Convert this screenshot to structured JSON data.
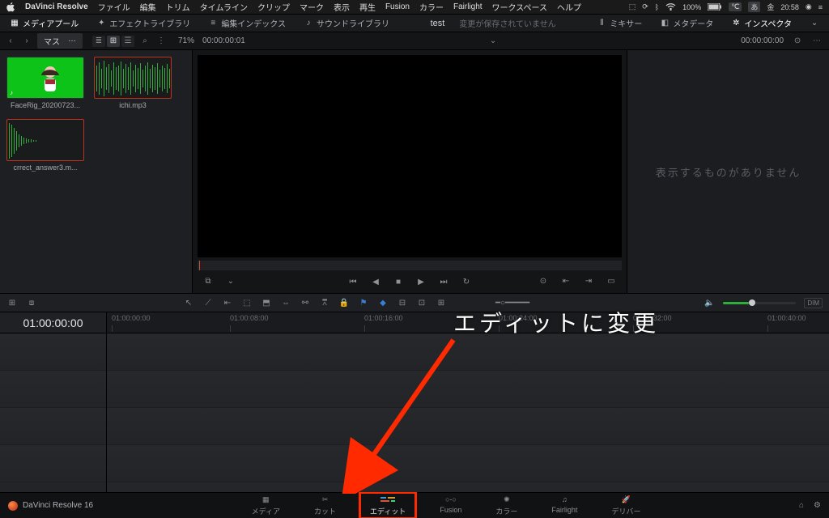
{
  "menubar": {
    "apple": "",
    "app": "DaVinci Resolve",
    "items": [
      "ファイル",
      "編集",
      "トリム",
      "タイムライン",
      "クリップ",
      "マーク",
      "表示",
      "再生",
      "Fusion",
      "カラー",
      "Fairlight",
      "ワークスペース",
      "ヘルプ"
    ],
    "status": {
      "battery": "100%",
      "ime1": "℃",
      "ime2": "あ",
      "day": "金",
      "time": "20:58"
    }
  },
  "toolbar": {
    "mediapool": "メディアプール",
    "effects": "エフェクトライブラリ",
    "editindex": "編集インデックス",
    "soundlib": "サウンドライブラリ",
    "title": "test",
    "unsaved": "変更が保存されていません",
    "mixer": "ミキサー",
    "metadata": "メタデータ",
    "inspector": "インスペクタ"
  },
  "subbar": {
    "crumb": "マス",
    "zoom": "71%",
    "tc_in": "00:00:00:01",
    "tc_out": "00:00:00:00"
  },
  "pool": {
    "clips": [
      {
        "label": "FaceRig_20200723...",
        "kind": "green"
      },
      {
        "label": "ichi.mp3",
        "kind": "audio",
        "selected": true
      },
      {
        "label": "crrect_answer3.m...",
        "kind": "audio",
        "selected": true
      }
    ]
  },
  "inspector": {
    "empty": "表示するものがありません"
  },
  "tltoolbar": {
    "dim": "DIM"
  },
  "ruler": {
    "tc": "01:00:00:00",
    "ticks": [
      "01:00:00:00",
      "01:00:08:00",
      "01:00:16:00",
      "01:00:24:00",
      "01:00:32:00",
      "01:00:40:00"
    ]
  },
  "annotation": {
    "text": "エディットに変更"
  },
  "pages": {
    "brand": "DaVinci Resolve 16",
    "tabs": [
      {
        "key": "media",
        "label": "メディア"
      },
      {
        "key": "cut",
        "label": "カット"
      },
      {
        "key": "edit",
        "label": "エディット"
      },
      {
        "key": "fusion",
        "label": "Fusion"
      },
      {
        "key": "color",
        "label": "カラー"
      },
      {
        "key": "fairlight",
        "label": "Fairlight"
      },
      {
        "key": "deliver",
        "label": "デリバー"
      }
    ],
    "active": "edit"
  }
}
